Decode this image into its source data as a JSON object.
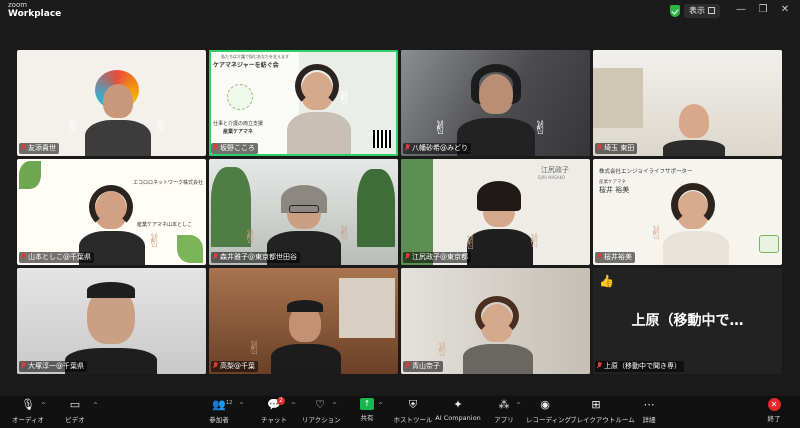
{
  "app": {
    "logo_line1": "zoom",
    "logo_line2": "Workplace"
  },
  "titlebar": {
    "view_label": "表示"
  },
  "tiles": [
    {
      "name": "友添貴世"
    },
    {
      "name": "坂野こころ"
    },
    {
      "name": "八幡砂希@みどり"
    },
    {
      "name": "埼玉 東田"
    },
    {
      "name": "山本としこ@千葉県"
    },
    {
      "name": "森井雅子@東京都世田谷"
    },
    {
      "name": "江尻政子@東京都"
    },
    {
      "name": "桜井裕美"
    },
    {
      "name": "大塚淳一@千葉県"
    },
    {
      "name": "高梨@千葉"
    },
    {
      "name": "青山奈子"
    },
    {
      "name": "上原（移動中で聞き専）",
      "big_label": "上原（移動中で…"
    }
  ],
  "slides": {
    "care": {
      "line1": "私たちは介護で悩むあなたを支えます",
      "title": "ケアマネジャーを紡ぐ会",
      "subtitle": "仕事と介護の両立支援",
      "org": "産業ケアマネ"
    },
    "ecoro": {
      "company": "エコロロネットワーク株式会社",
      "role": "産業ケアマネ",
      "person": "山本としこ"
    },
    "ejiri": {
      "name": "江尻政子",
      "romaji": "EJIRI MASAKO"
    },
    "sakurai": {
      "company": "株式会社エンジョイライフサポーター",
      "role": "産業ケアマネ",
      "name": "桜井 裕美"
    }
  },
  "toolbar": {
    "audio": "オーディオ",
    "video": "ビデオ",
    "participants": "参加者",
    "participants_count": "12",
    "chat": "チャット",
    "chat_badge": "2",
    "reactions": "リアクション",
    "share": "共有",
    "host_tools": "ホストツール",
    "ai_companion": "AI Companion",
    "apps": "アプリ",
    "record": "レコーディング",
    "breakout": "ブレイクアウトルーム",
    "more": "詳細",
    "end": "終了"
  },
  "colors": {
    "active_speaker": "#2fd06a",
    "share": "#18b550",
    "end": "#e02828"
  }
}
